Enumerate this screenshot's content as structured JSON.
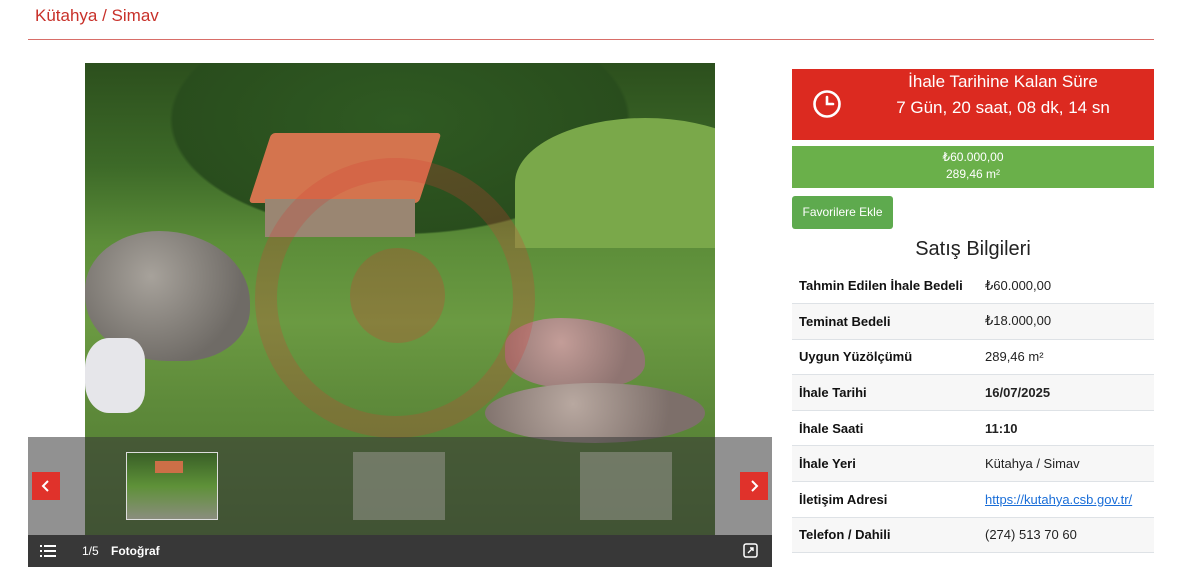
{
  "header": {
    "title": "Kütahya / Simav"
  },
  "gallery": {
    "counter": "1/5",
    "label": "Fotoğraf",
    "prev_icon": "chevron-left-icon",
    "next_icon": "chevron-right-icon",
    "list_icon": "list-icon",
    "expand_icon": "expand-icon"
  },
  "timer": {
    "title": "İhale Tarihine Kalan Süre",
    "value": "7 Gün, 20 saat, 08 dk, 14 sn",
    "icon": "clock-icon",
    "color": "#dc2a20"
  },
  "price": {
    "amount": "₺60.000,00",
    "area": "289,46 m²",
    "color": "#6ab04a"
  },
  "favorite_button": {
    "label": "Favorilere Ekle"
  },
  "sales_info": {
    "title": "Satış Bilgileri",
    "rows": [
      {
        "key": "Tahmin Edilen İhale Bedeli",
        "value": "₺60.000,00"
      },
      {
        "key": "Teminat Bedeli",
        "value": "₺18.000,00"
      },
      {
        "key": "Uygun Yüzölçümü",
        "value": "289,46 m²"
      },
      {
        "key": "İhale Tarihi",
        "value": "16/07/2025"
      },
      {
        "key": "İhale Saati",
        "value": "11:10"
      },
      {
        "key": "İhale Yeri",
        "value": "Kütahya / Simav"
      },
      {
        "key": "İletişim Adresi",
        "value": "https://kutahya.csb.gov.tr/"
      },
      {
        "key": "Telefon / Dahili",
        "value": "(274) 513 70 60"
      }
    ]
  },
  "accent_color": "#c8312a"
}
